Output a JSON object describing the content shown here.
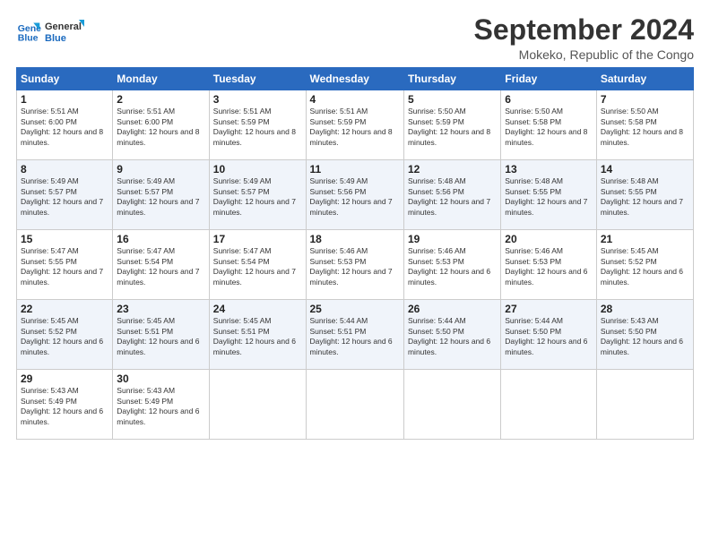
{
  "logo": {
    "line1": "General",
    "line2": "Blue"
  },
  "title": "September 2024",
  "location": "Mokeko, Republic of the Congo",
  "weekdays": [
    "Sunday",
    "Monday",
    "Tuesday",
    "Wednesday",
    "Thursday",
    "Friday",
    "Saturday"
  ],
  "weeks": [
    [
      {
        "day": "1",
        "sunrise": "5:51 AM",
        "sunset": "6:00 PM",
        "daylight": "12 hours and 8 minutes."
      },
      {
        "day": "2",
        "sunrise": "5:51 AM",
        "sunset": "6:00 PM",
        "daylight": "12 hours and 8 minutes."
      },
      {
        "day": "3",
        "sunrise": "5:51 AM",
        "sunset": "5:59 PM",
        "daylight": "12 hours and 8 minutes."
      },
      {
        "day": "4",
        "sunrise": "5:51 AM",
        "sunset": "5:59 PM",
        "daylight": "12 hours and 8 minutes."
      },
      {
        "day": "5",
        "sunrise": "5:50 AM",
        "sunset": "5:59 PM",
        "daylight": "12 hours and 8 minutes."
      },
      {
        "day": "6",
        "sunrise": "5:50 AM",
        "sunset": "5:58 PM",
        "daylight": "12 hours and 8 minutes."
      },
      {
        "day": "7",
        "sunrise": "5:50 AM",
        "sunset": "5:58 PM",
        "daylight": "12 hours and 8 minutes."
      }
    ],
    [
      {
        "day": "8",
        "sunrise": "5:49 AM",
        "sunset": "5:57 PM",
        "daylight": "12 hours and 7 minutes."
      },
      {
        "day": "9",
        "sunrise": "5:49 AM",
        "sunset": "5:57 PM",
        "daylight": "12 hours and 7 minutes."
      },
      {
        "day": "10",
        "sunrise": "5:49 AM",
        "sunset": "5:57 PM",
        "daylight": "12 hours and 7 minutes."
      },
      {
        "day": "11",
        "sunrise": "5:49 AM",
        "sunset": "5:56 PM",
        "daylight": "12 hours and 7 minutes."
      },
      {
        "day": "12",
        "sunrise": "5:48 AM",
        "sunset": "5:56 PM",
        "daylight": "12 hours and 7 minutes."
      },
      {
        "day": "13",
        "sunrise": "5:48 AM",
        "sunset": "5:55 PM",
        "daylight": "12 hours and 7 minutes."
      },
      {
        "day": "14",
        "sunrise": "5:48 AM",
        "sunset": "5:55 PM",
        "daylight": "12 hours and 7 minutes."
      }
    ],
    [
      {
        "day": "15",
        "sunrise": "5:47 AM",
        "sunset": "5:55 PM",
        "daylight": "12 hours and 7 minutes."
      },
      {
        "day": "16",
        "sunrise": "5:47 AM",
        "sunset": "5:54 PM",
        "daylight": "12 hours and 7 minutes."
      },
      {
        "day": "17",
        "sunrise": "5:47 AM",
        "sunset": "5:54 PM",
        "daylight": "12 hours and 7 minutes."
      },
      {
        "day": "18",
        "sunrise": "5:46 AM",
        "sunset": "5:53 PM",
        "daylight": "12 hours and 7 minutes."
      },
      {
        "day": "19",
        "sunrise": "5:46 AM",
        "sunset": "5:53 PM",
        "daylight": "12 hours and 6 minutes."
      },
      {
        "day": "20",
        "sunrise": "5:46 AM",
        "sunset": "5:53 PM",
        "daylight": "12 hours and 6 minutes."
      },
      {
        "day": "21",
        "sunrise": "5:45 AM",
        "sunset": "5:52 PM",
        "daylight": "12 hours and 6 minutes."
      }
    ],
    [
      {
        "day": "22",
        "sunrise": "5:45 AM",
        "sunset": "5:52 PM",
        "daylight": "12 hours and 6 minutes."
      },
      {
        "day": "23",
        "sunrise": "5:45 AM",
        "sunset": "5:51 PM",
        "daylight": "12 hours and 6 minutes."
      },
      {
        "day": "24",
        "sunrise": "5:45 AM",
        "sunset": "5:51 PM",
        "daylight": "12 hours and 6 minutes."
      },
      {
        "day": "25",
        "sunrise": "5:44 AM",
        "sunset": "5:51 PM",
        "daylight": "12 hours and 6 minutes."
      },
      {
        "day": "26",
        "sunrise": "5:44 AM",
        "sunset": "5:50 PM",
        "daylight": "12 hours and 6 minutes."
      },
      {
        "day": "27",
        "sunrise": "5:44 AM",
        "sunset": "5:50 PM",
        "daylight": "12 hours and 6 minutes."
      },
      {
        "day": "28",
        "sunrise": "5:43 AM",
        "sunset": "5:50 PM",
        "daylight": "12 hours and 6 minutes."
      }
    ],
    [
      {
        "day": "29",
        "sunrise": "5:43 AM",
        "sunset": "5:49 PM",
        "daylight": "12 hours and 6 minutes."
      },
      {
        "day": "30",
        "sunrise": "5:43 AM",
        "sunset": "5:49 PM",
        "daylight": "12 hours and 6 minutes."
      },
      null,
      null,
      null,
      null,
      null
    ]
  ]
}
